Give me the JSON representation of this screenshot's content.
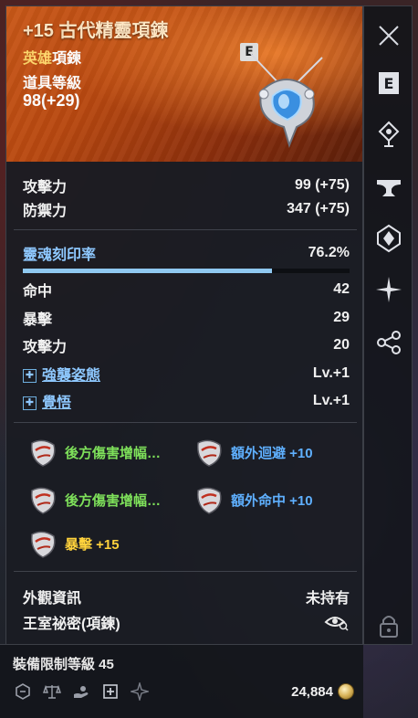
{
  "item": {
    "name": "+15 古代精靈項鍊",
    "grade": "英雄",
    "slot": "項鍊",
    "level_label": "道具等級",
    "level_value": "98(+29)",
    "badge": "E"
  },
  "base_stats": [
    {
      "label": "攻擊力",
      "value": "99 (+75)"
    },
    {
      "label": "防禦力",
      "value": "347 (+75)"
    }
  ],
  "soul": {
    "label": "靈魂刻印率",
    "value": "76.2%",
    "fill_percent": 76.2
  },
  "extra_stats": [
    {
      "label": "命中",
      "value": "42"
    },
    {
      "label": "暴擊",
      "value": "29"
    },
    {
      "label": "攻擊力",
      "value": "20"
    }
  ],
  "skills": [
    {
      "name": "強襲姿態",
      "level": "Lv.+1",
      "icon": "plus-box-icon"
    },
    {
      "name": "覺悟",
      "level": "Lv.+1",
      "icon": "plus-box-icon"
    }
  ],
  "engravings": [
    {
      "text": "後方傷害增幅…",
      "color": "green"
    },
    {
      "text": "額外迴避 +10",
      "color": "blue"
    },
    {
      "text": "後方傷害增幅…",
      "color": "green"
    },
    {
      "text": "額外命中 +10",
      "color": "blue"
    },
    {
      "text": "暴擊 +15",
      "color": "yellow"
    }
  ],
  "appearance": {
    "label": "外觀資訊",
    "status": "未持有",
    "name": "王室祕密(項鍊)"
  },
  "footer": {
    "requirement": "裝備限制等級 45",
    "price": "24,884",
    "icons": [
      "trade-icon",
      "balance-icon",
      "hand-icon",
      "plus-box-icon",
      "compass-icon"
    ]
  },
  "sidebar": {
    "buttons": [
      "close-icon",
      "e-key-icon",
      "location-icon",
      "anvil-icon",
      "crystal-icon",
      "sparkle-icon",
      "share-icon",
      "lock-icon"
    ]
  },
  "colors": {
    "header": "#c95818",
    "grade": "#ffd76a",
    "green": "#7ee05a",
    "blue": "#5fb0ff",
    "yellow": "#ffd23c",
    "soul_bar": "#8fc8f0"
  }
}
